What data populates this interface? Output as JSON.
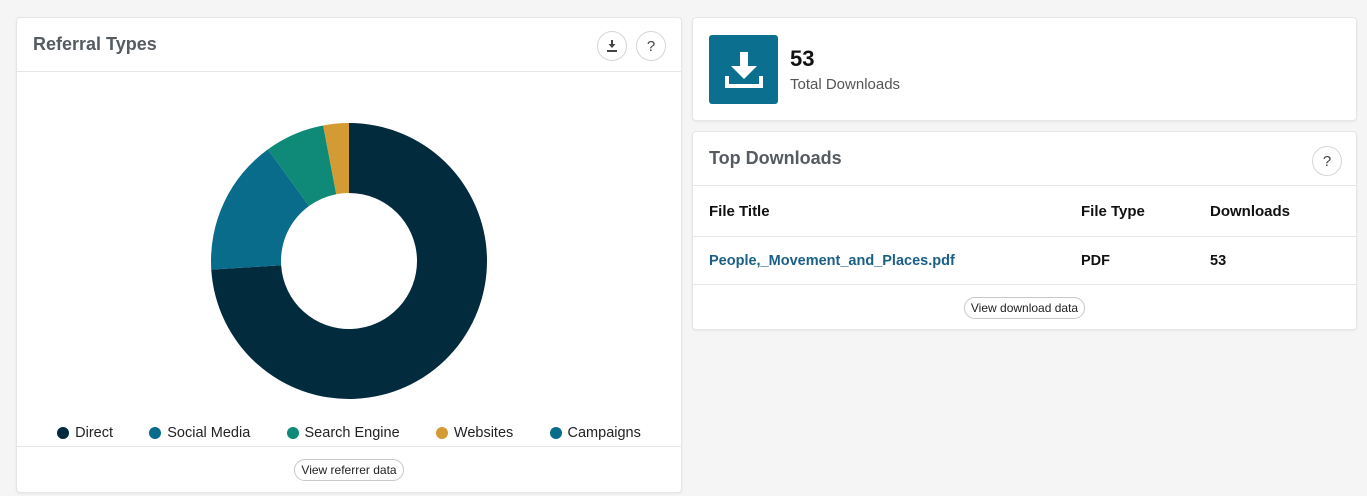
{
  "referral": {
    "title": "Referral Types",
    "footer_button": "View referrer data",
    "download_icon": "download-icon",
    "help_label": "?"
  },
  "chart_data": {
    "type": "pie",
    "title": "",
    "categories": [
      "Direct",
      "Social Media",
      "Search Engine",
      "Websites",
      "Campaigns"
    ],
    "values": [
      74,
      16,
      7,
      3,
      0
    ],
    "colors": [
      "#022b3e",
      "#0a6c8b",
      "#0f8a78",
      "#d49b34",
      "#0a6c8b"
    ],
    "donut": true,
    "legend_placement": "bottom"
  },
  "total": {
    "value": "53",
    "label": "Total Downloads",
    "icon": "download-icon",
    "tile_color": "#0b6f8f"
  },
  "top_downloads": {
    "title": "Top Downloads",
    "help_label": "?",
    "columns": [
      "File Title",
      "File Type",
      "Downloads"
    ],
    "rows": [
      [
        "People,_Movement_and_Places.pdf",
        "PDF",
        "53"
      ]
    ],
    "footer_button": "View download data"
  }
}
